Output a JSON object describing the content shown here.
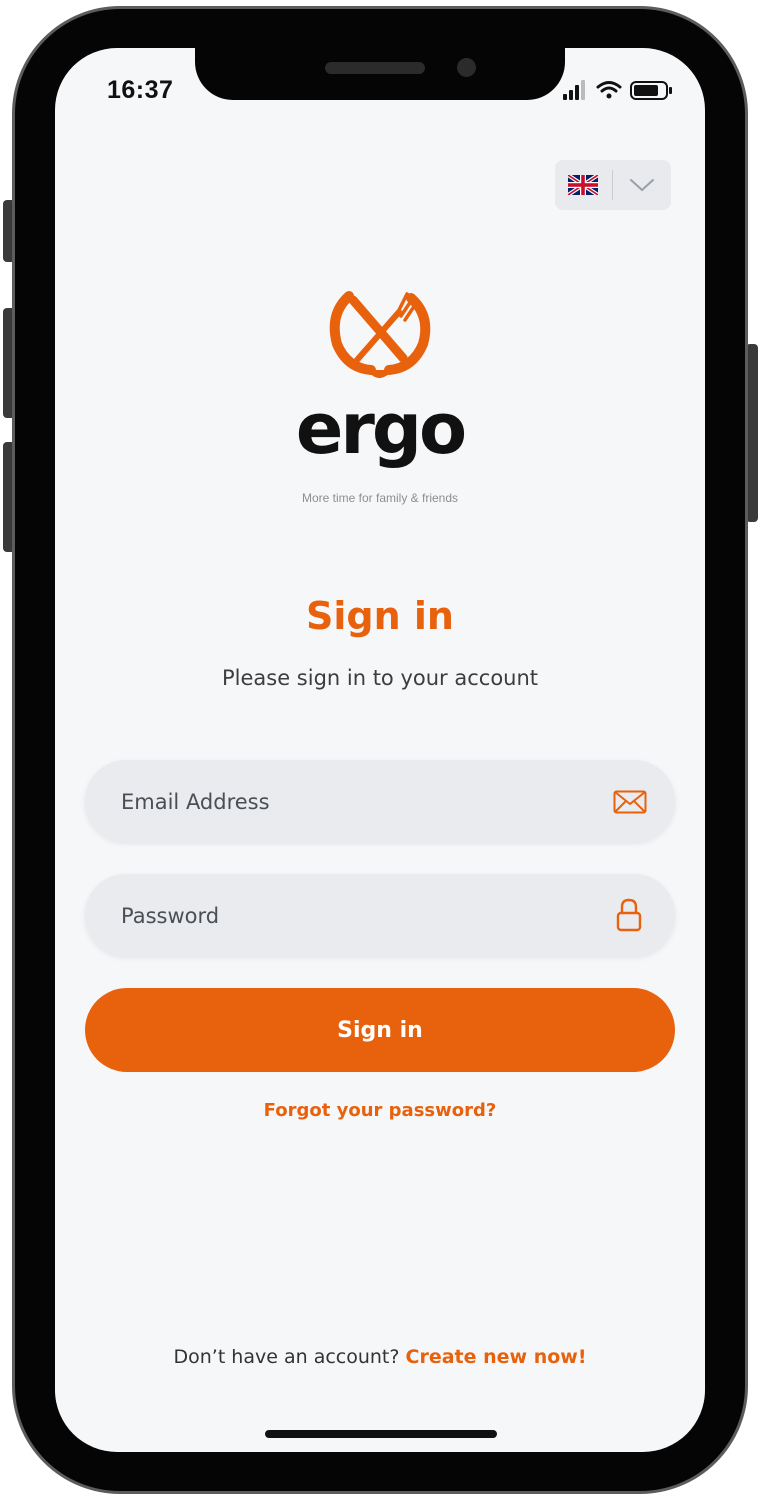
{
  "status_bar": {
    "time": "16:37",
    "icons": [
      "signal-icon",
      "wifi-icon",
      "battery-icon"
    ]
  },
  "language": {
    "selected": "English",
    "flag_icon": "uk-flag-icon",
    "dropdown_icon": "chevron-down-icon"
  },
  "brand": {
    "logo_icon": "fork-knife-logo-icon",
    "name": "ergo",
    "tagline": "More time for family & friends"
  },
  "signin": {
    "title": "Sign in",
    "subtitle": "Please sign in to your account",
    "email_placeholder": "Email Address",
    "password_placeholder": "Password",
    "submit_label": "Sign in",
    "forgot_label": "Forgot your password?"
  },
  "signup": {
    "prompt": "Don’t have an account?",
    "link_label": "Create new now!"
  },
  "colors": {
    "accent": "#e8610c",
    "background": "#f6f7f9",
    "field": "#e9ebee"
  }
}
